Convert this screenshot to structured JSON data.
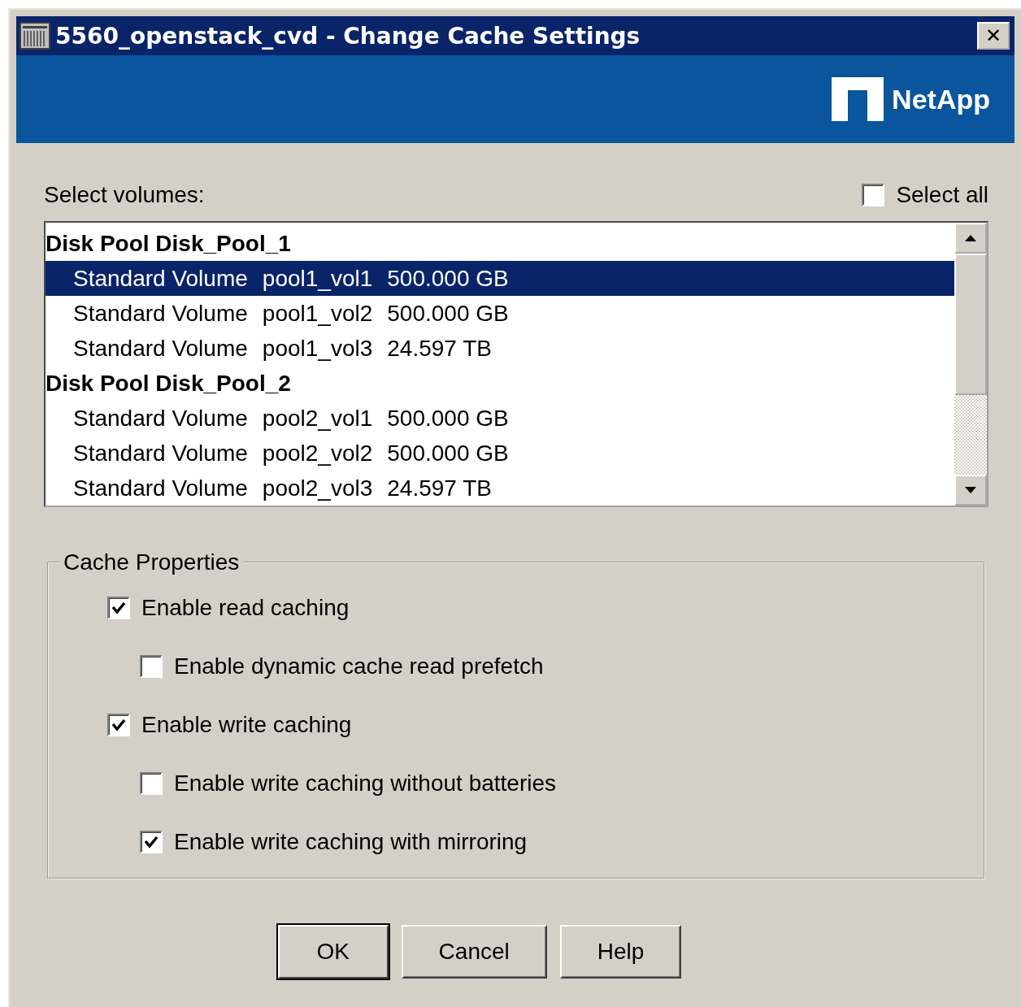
{
  "window": {
    "title": "5560_openstack_cvd - Change Cache Settings",
    "close": "✕"
  },
  "banner": {
    "logo_text": "NetApp"
  },
  "volumes": {
    "label": "Select volumes:",
    "select_all": {
      "label": "Select all",
      "checked": false
    },
    "groups": [
      {
        "title": "Disk Pool Disk_Pool_1",
        "items": [
          {
            "type": "Standard Volume",
            "name": "pool1_vol1",
            "capacity": "500.000 GB",
            "selected": true
          },
          {
            "type": "Standard Volume",
            "name": "pool1_vol2",
            "capacity": "500.000 GB",
            "selected": false
          },
          {
            "type": "Standard Volume",
            "name": "pool1_vol3",
            "capacity": "24.597 TB",
            "selected": false
          }
        ]
      },
      {
        "title": "Disk Pool Disk_Pool_2",
        "items": [
          {
            "type": "Standard Volume",
            "name": "pool2_vol1",
            "capacity": "500.000 GB",
            "selected": false
          },
          {
            "type": "Standard Volume",
            "name": "pool2_vol2",
            "capacity": "500.000 GB",
            "selected": false
          },
          {
            "type": "Standard Volume",
            "name": "pool2_vol3",
            "capacity": "24.597 TB",
            "selected": false
          }
        ]
      }
    ]
  },
  "cache_properties": {
    "title": "Cache Properties",
    "options": [
      {
        "label": "Enable read caching",
        "checked": true,
        "children": [
          {
            "label": "Enable dynamic cache read prefetch",
            "checked": false
          }
        ]
      },
      {
        "label": "Enable write caching",
        "checked": true,
        "children": [
          {
            "label": "Enable write caching without batteries",
            "checked": false
          },
          {
            "label": "Enable write caching with mirroring",
            "checked": true
          }
        ]
      }
    ]
  },
  "buttons": [
    {
      "label": "OK",
      "default": true
    },
    {
      "label": "Cancel",
      "default": false
    },
    {
      "label": "Help",
      "default": false
    }
  ]
}
